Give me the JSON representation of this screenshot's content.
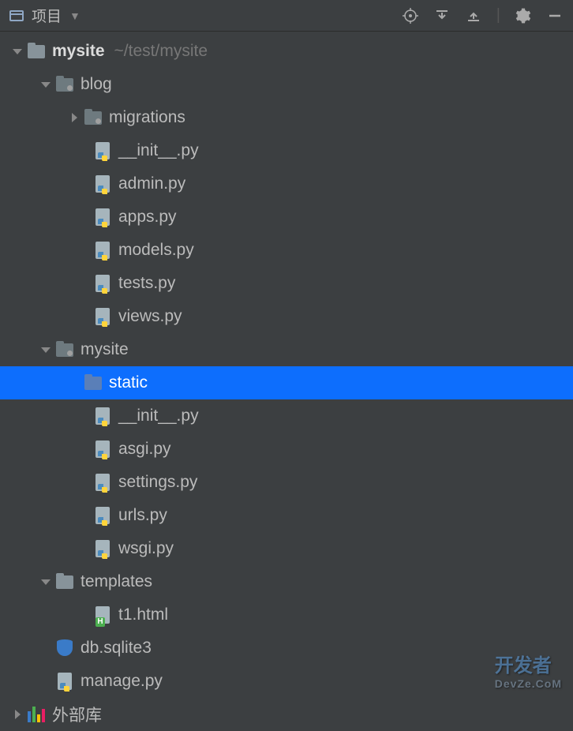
{
  "header": {
    "title": "项目"
  },
  "tree": {
    "root": {
      "name": "mysite",
      "path": "~/test/mysite"
    },
    "blog": {
      "name": "blog",
      "migrations": "migrations",
      "files": [
        "__init__.py",
        "admin.py",
        "apps.py",
        "models.py",
        "tests.py",
        "views.py"
      ]
    },
    "mysite": {
      "name": "mysite",
      "static": "static",
      "files": [
        "__init__.py",
        "asgi.py",
        "settings.py",
        "urls.py",
        "wsgi.py"
      ]
    },
    "templates": {
      "name": "templates",
      "files": [
        "t1.html"
      ]
    },
    "rootFiles": {
      "db": "db.sqlite3",
      "manage": "manage.py"
    },
    "external": "外部库"
  },
  "watermark": {
    "main": "开发者",
    "sub": "DevZe.CoM"
  }
}
